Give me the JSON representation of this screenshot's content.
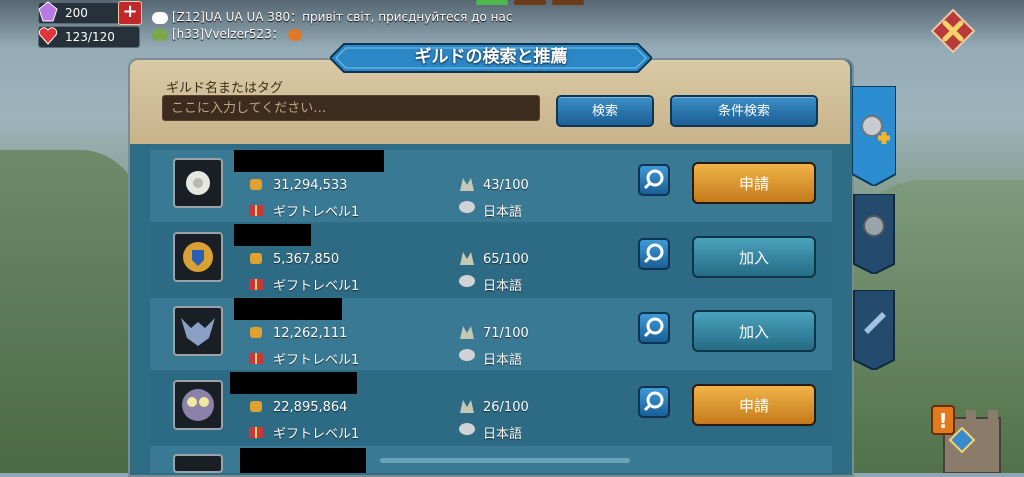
{
  "resources": {
    "gems": "200",
    "stamina": "123/120"
  },
  "chat": [
    {
      "text": "[Z12]UA UA UA 380：привіт світ, приєднуйтеся до нас"
    },
    {
      "text": "[h33]Vvelzer523："
    }
  ],
  "title": "ギルドの検索と推薦",
  "search": {
    "label": "ギルド名またはタグ",
    "placeholder": "ここに入力してください…",
    "search_button": "検索",
    "advanced_button": "条件検索"
  },
  "guilds": [
    {
      "power": "31,294,533",
      "gift": "ギフトレベル1",
      "members": "43/100",
      "language": "日本語",
      "action": "申請",
      "action_type": "apply",
      "emblem": "white-flower-emblem"
    },
    {
      "power": "5,367,850",
      "gift": "ギフトレベル1",
      "members": "65/100",
      "language": "日本語",
      "action": "加入",
      "action_type": "join",
      "emblem": "gold-shield-emblem"
    },
    {
      "power": "12,262,111",
      "gift": "ギフトレベル1",
      "members": "71/100",
      "language": "日本語",
      "action": "加入",
      "action_type": "join",
      "emblem": "horned-skull-emblem"
    },
    {
      "power": "22,895,864",
      "gift": "ギフトレベル1",
      "members": "26/100",
      "language": "日本語",
      "action": "申請",
      "action_type": "apply",
      "emblem": "owl-emblem"
    }
  ],
  "colors": {
    "apply": "#e0a033",
    "join": "#3a8aa5",
    "panel": "#2f6d86",
    "search_area": "#d3c199"
  }
}
